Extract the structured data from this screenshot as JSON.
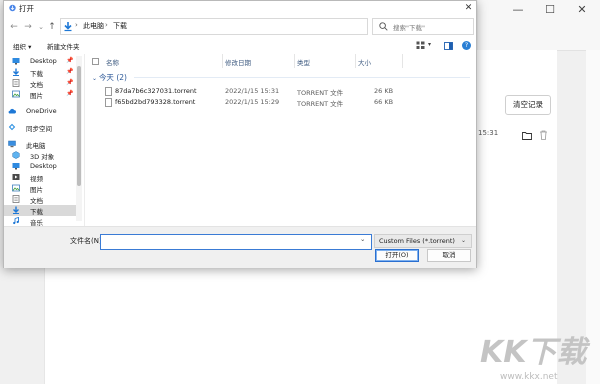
{
  "dialog": {
    "title": "打开",
    "nav": {
      "back": "←",
      "forward": "→",
      "up_dropdown": "⌄",
      "up": "↑"
    },
    "address": {
      "crumbs": [
        "此电脑",
        "下载"
      ],
      "separator": "›",
      "dropdown": "⌄",
      "refresh": "↻"
    },
    "search_placeholder": "搜索\"下载\"",
    "toolbar": {
      "organize": "组织 ▾",
      "new_folder": "新建文件夹",
      "view_dropdown": "▾"
    },
    "sidebar": [
      {
        "label": "Desktop",
        "icon": "desktop-icon",
        "pinned": true
      },
      {
        "label": "下载",
        "icon": "download-arrow-icon",
        "pinned": true
      },
      {
        "label": "文档",
        "icon": "document-icon",
        "pinned": true
      },
      {
        "label": "图片",
        "icon": "picture-icon",
        "pinned": true
      },
      {
        "label": "OneDrive",
        "icon": "cloud-icon",
        "pinned": false
      },
      {
        "label": "同步空间",
        "icon": "sync-space-icon",
        "pinned": false
      },
      {
        "label": "此电脑",
        "icon": "computer-icon",
        "pinned": false
      },
      {
        "label": "3D 对象",
        "icon": "3d-objects-icon",
        "pinned": false
      },
      {
        "label": "Desktop",
        "icon": "desktop-icon",
        "pinned": false
      },
      {
        "label": "视频",
        "icon": "video-icon",
        "pinned": false
      },
      {
        "label": "图片",
        "icon": "picture-icon",
        "pinned": false
      },
      {
        "label": "文档",
        "icon": "document-icon",
        "pinned": false
      },
      {
        "label": "下载",
        "icon": "download-arrow-icon",
        "pinned": false,
        "selected": true
      },
      {
        "label": "音乐",
        "icon": "music-icon",
        "pinned": false
      }
    ],
    "pin_glyph": "📌",
    "columns": {
      "name": "名称",
      "modified": "修改日期",
      "type": "类型",
      "size": "大小"
    },
    "group": {
      "label": "今天 (2)"
    },
    "files": [
      {
        "name": "87da7b6c327031.torrent",
        "modified": "2022/1/15 15:31",
        "type": "TORRENT 文件",
        "size": "26 KB"
      },
      {
        "name": "f65bd2bd793328.torrent",
        "modified": "2022/1/15 15:29",
        "type": "TORRENT 文件",
        "size": "66 KB"
      }
    ],
    "filename_label": "文件名(N):",
    "filename_value": "",
    "filter": "Custom Files (*.torrent)",
    "open_button": "打开(O)",
    "cancel_button": "取消",
    "close_glyph": "✕",
    "dropdown_glyph": "⌄"
  },
  "background": {
    "window_controls": {
      "minimize": "—",
      "maximize": "☐",
      "close": "✕"
    },
    "clear_button": "清空记录",
    "time": "15:31"
  },
  "watermark": {
    "brand": "KK下载",
    "url": "www.kkx.net"
  },
  "colors": {
    "accent": "#2a7fd4",
    "folder_blue": "#1e78d6",
    "watermark": "#b9b9b9"
  }
}
